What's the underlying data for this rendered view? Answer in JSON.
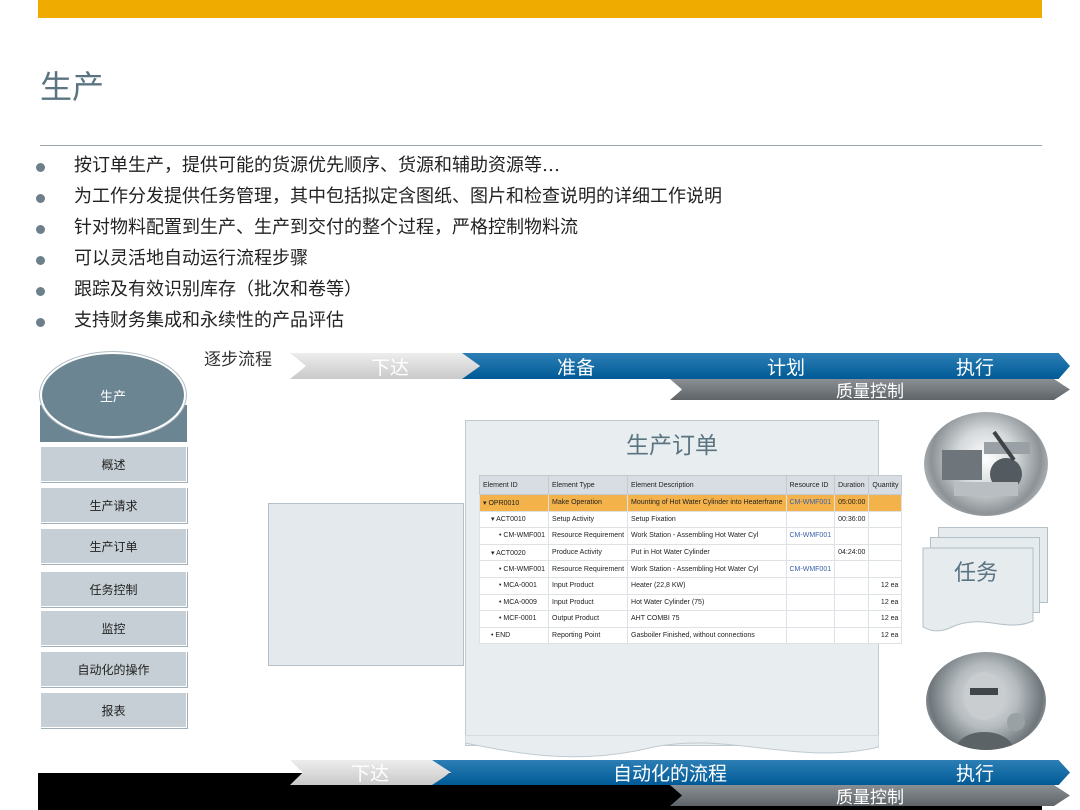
{
  "page": {
    "title": "生产",
    "bullets": [
      "按订单生产，提供可能的货源优先顺序、货源和辅助资源等…",
      "为工作分发提供任务管理，其中包括拟定含图纸、图片和检查说明的详细工作说明",
      "针对物料配置到生产、生产到交付的整个过程，严格控制物料流",
      "可以灵活地自动运行流程步骤",
      "跟踪及有效识别库存（批次和卷等）",
      "支持财务集成和永续性的产品评估"
    ]
  },
  "process": {
    "label": "逐步流程",
    "steps": [
      "下达",
      "准备",
      "计划",
      "执行"
    ],
    "quality": "质量控制"
  },
  "sidebar": {
    "header": "生产",
    "items": [
      "概述",
      "生产请求",
      "生产订单",
      "任务控制",
      "监控",
      "自动化的操作",
      "报表"
    ]
  },
  "order": {
    "title": "生产订单",
    "columns": [
      "Element ID",
      "Element Type",
      "Element Description",
      "Resource ID",
      "Duration",
      "Quantity"
    ],
    "rows": [
      {
        "id": "OPR0010",
        "type": "Make Operation",
        "desc": "Mounting of Hot Water Cylinder into Heaterframe",
        "res": "CM-WMF001",
        "dur": "05:00:00",
        "qty": ""
      },
      {
        "id": "ACT0010",
        "type": "Setup Activity",
        "desc": "Setup Fixation",
        "res": "",
        "dur": "00:36:00",
        "qty": ""
      },
      {
        "id": "CM-WMF001",
        "type": "Resource Requirement",
        "desc": "Work Station - Assembling Hot Water Cyl",
        "res": "CM-WMF001",
        "dur": "",
        "qty": ""
      },
      {
        "id": "ACT0020",
        "type": "Produce Activity",
        "desc": "Put in Hot Water Cylinder",
        "res": "",
        "dur": "04:24:00",
        "qty": ""
      },
      {
        "id": "CM-WMF001",
        "type": "Resource Requirement",
        "desc": "Work Station - Assembling Hot Water Cyl",
        "res": "CM-WMF001",
        "dur": "",
        "qty": ""
      },
      {
        "id": "MCA-0001",
        "type": "Input Product",
        "desc": "Heater (22,8 KW)",
        "res": "",
        "dur": "",
        "qty": "12 ea"
      },
      {
        "id": "MCA-0009",
        "type": "Input Product",
        "desc": "Hot Water Cylinder (75)",
        "res": "",
        "dur": "",
        "qty": "12 ea"
      },
      {
        "id": "MCF-0001",
        "type": "Output Product",
        "desc": "AHT COMBI 75",
        "res": "",
        "dur": "",
        "qty": "12 ea"
      },
      {
        "id": "END",
        "type": "Reporting Point",
        "desc": "Gasboiler Finished, without connections",
        "res": "",
        "dur": "",
        "qty": "12 ea"
      }
    ]
  },
  "task": {
    "label": "任务"
  },
  "bottom": {
    "steps": [
      "下达",
      "自动化的流程",
      "执行"
    ],
    "quality": "质量控制"
  },
  "colors": {
    "accent": "#f0ab00",
    "blue": "#005a96",
    "slate": "#6c8593"
  }
}
